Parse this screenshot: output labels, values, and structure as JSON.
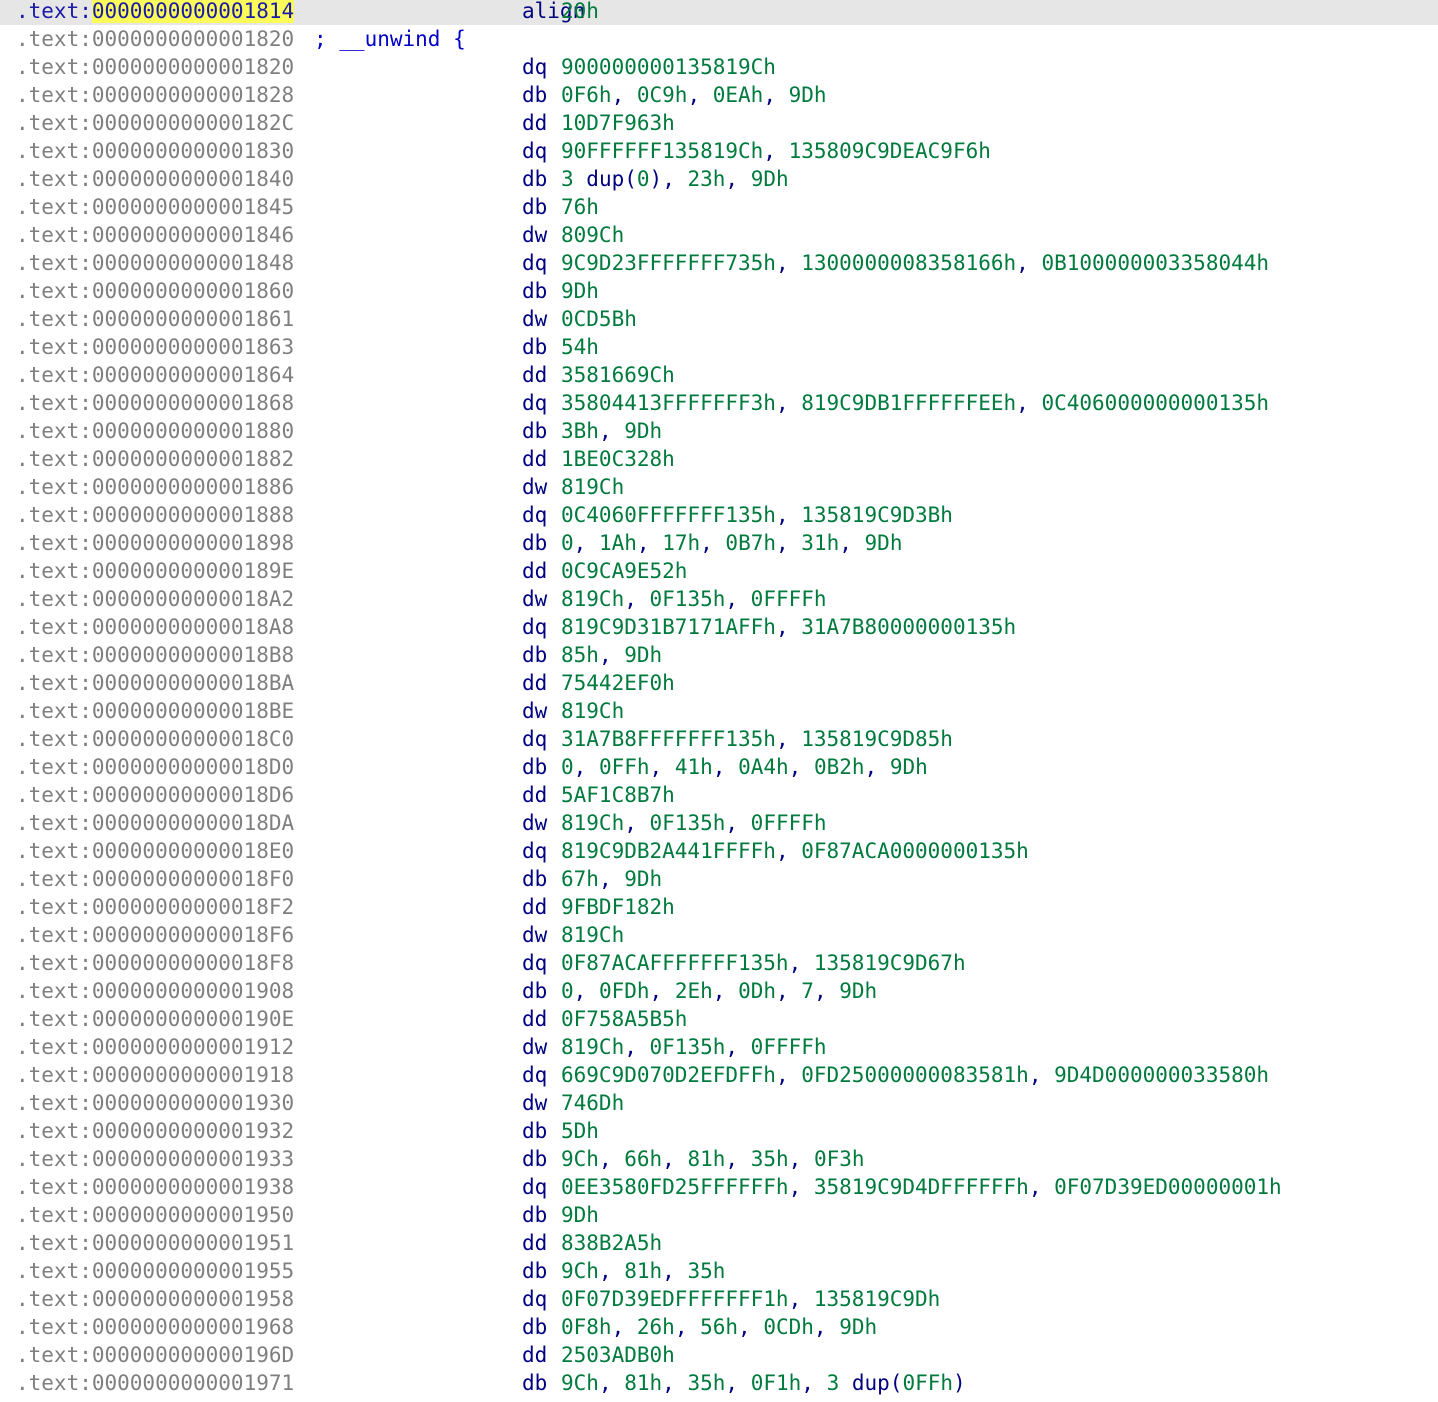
{
  "colors": {
    "address": "#7f7f7f",
    "address_current": "#1a1aa6",
    "current_highlight": "#fbfb5a",
    "current_line_bg": "#e6e6e6",
    "mnemonic": "#000080",
    "operand": "#007a3d",
    "comment": "#0000c8"
  },
  "listing": {
    "current_index": 0,
    "lines": [
      {
        "seg": ".text:",
        "offs": "0000000000001814",
        "mnem": "align",
        "ops": "20h"
      },
      {
        "seg": ".text:",
        "offs": "0000000000001820",
        "comment": "; __unwind {"
      },
      {
        "seg": ".text:",
        "offs": "0000000000001820",
        "mnem": "dq",
        "ops": "900000000135819Ch"
      },
      {
        "seg": ".text:",
        "offs": "0000000000001828",
        "mnem": "db",
        "ops": "0F6h, 0C9h, 0EAh, 9Dh"
      },
      {
        "seg": ".text:",
        "offs": "000000000000182C",
        "mnem": "dd",
        "ops": "10D7F963h"
      },
      {
        "seg": ".text:",
        "offs": "0000000000001830",
        "mnem": "dq",
        "ops": "90FFFFFF135819Ch, 135809C9DEAC9F6h"
      },
      {
        "seg": ".text:",
        "offs": "0000000000001840",
        "mnem": "db",
        "ops": "3 dup(0), 23h, 9Dh"
      },
      {
        "seg": ".text:",
        "offs": "0000000000001845",
        "mnem": "db",
        "ops": "76h"
      },
      {
        "seg": ".text:",
        "offs": "0000000000001846",
        "mnem": "dw",
        "ops": "809Ch"
      },
      {
        "seg": ".text:",
        "offs": "0000000000001848",
        "mnem": "dq",
        "ops": "9C9D23FFFFFFF735h, 1300000008358166h, 0B100000003358044h"
      },
      {
        "seg": ".text:",
        "offs": "0000000000001860",
        "mnem": "db",
        "ops": "9Dh"
      },
      {
        "seg": ".text:",
        "offs": "0000000000001861",
        "mnem": "dw",
        "ops": "0CD5Bh"
      },
      {
        "seg": ".text:",
        "offs": "0000000000001863",
        "mnem": "db",
        "ops": "54h"
      },
      {
        "seg": ".text:",
        "offs": "0000000000001864",
        "mnem": "dd",
        "ops": "3581669Ch"
      },
      {
        "seg": ".text:",
        "offs": "0000000000001868",
        "mnem": "dq",
        "ops": "35804413FFFFFFF3h, 819C9DB1FFFFFFEEh, 0C406000000000135h"
      },
      {
        "seg": ".text:",
        "offs": "0000000000001880",
        "mnem": "db",
        "ops": "3Bh, 9Dh"
      },
      {
        "seg": ".text:",
        "offs": "0000000000001882",
        "mnem": "dd",
        "ops": "1BE0C328h"
      },
      {
        "seg": ".text:",
        "offs": "0000000000001886",
        "mnem": "dw",
        "ops": "819Ch"
      },
      {
        "seg": ".text:",
        "offs": "0000000000001888",
        "mnem": "dq",
        "ops": "0C4060FFFFFFF135h, 135819C9D3Bh"
      },
      {
        "seg": ".text:",
        "offs": "0000000000001898",
        "mnem": "db",
        "ops": "0, 1Ah, 17h, 0B7h, 31h, 9Dh"
      },
      {
        "seg": ".text:",
        "offs": "000000000000189E",
        "mnem": "dd",
        "ops": "0C9CA9E52h"
      },
      {
        "seg": ".text:",
        "offs": "00000000000018A2",
        "mnem": "dw",
        "ops": "819Ch, 0F135h, 0FFFFh"
      },
      {
        "seg": ".text:",
        "offs": "00000000000018A8",
        "mnem": "dq",
        "ops": "819C9D31B7171AFFh, 31A7B80000000135h"
      },
      {
        "seg": ".text:",
        "offs": "00000000000018B8",
        "mnem": "db",
        "ops": "85h, 9Dh"
      },
      {
        "seg": ".text:",
        "offs": "00000000000018BA",
        "mnem": "dd",
        "ops": "75442EF0h"
      },
      {
        "seg": ".text:",
        "offs": "00000000000018BE",
        "mnem": "dw",
        "ops": "819Ch"
      },
      {
        "seg": ".text:",
        "offs": "00000000000018C0",
        "mnem": "dq",
        "ops": "31A7B8FFFFFFF135h, 135819C9D85h"
      },
      {
        "seg": ".text:",
        "offs": "00000000000018D0",
        "mnem": "db",
        "ops": "0, 0FFh, 41h, 0A4h, 0B2h, 9Dh"
      },
      {
        "seg": ".text:",
        "offs": "00000000000018D6",
        "mnem": "dd",
        "ops": "5AF1C8B7h"
      },
      {
        "seg": ".text:",
        "offs": "00000000000018DA",
        "mnem": "dw",
        "ops": "819Ch, 0F135h, 0FFFFh"
      },
      {
        "seg": ".text:",
        "offs": "00000000000018E0",
        "mnem": "dq",
        "ops": "819C9DB2A441FFFFh, 0F87ACA0000000135h"
      },
      {
        "seg": ".text:",
        "offs": "00000000000018F0",
        "mnem": "db",
        "ops": "67h, 9Dh"
      },
      {
        "seg": ".text:",
        "offs": "00000000000018F2",
        "mnem": "dd",
        "ops": "9FBDF182h"
      },
      {
        "seg": ".text:",
        "offs": "00000000000018F6",
        "mnem": "dw",
        "ops": "819Ch"
      },
      {
        "seg": ".text:",
        "offs": "00000000000018F8",
        "mnem": "dq",
        "ops": "0F87ACAFFFFFFF135h, 135819C9D67h"
      },
      {
        "seg": ".text:",
        "offs": "0000000000001908",
        "mnem": "db",
        "ops": "0, 0FDh, 2Eh, 0Dh, 7, 9Dh"
      },
      {
        "seg": ".text:",
        "offs": "000000000000190E",
        "mnem": "dd",
        "ops": "0F758A5B5h"
      },
      {
        "seg": ".text:",
        "offs": "0000000000001912",
        "mnem": "dw",
        "ops": "819Ch, 0F135h, 0FFFFh"
      },
      {
        "seg": ".text:",
        "offs": "0000000000001918",
        "mnem": "dq",
        "ops": "669C9D070D2EFDFFh, 0FD25000000083581h, 9D4D000000033580h"
      },
      {
        "seg": ".text:",
        "offs": "0000000000001930",
        "mnem": "dw",
        "ops": "746Dh"
      },
      {
        "seg": ".text:",
        "offs": "0000000000001932",
        "mnem": "db",
        "ops": "5Dh"
      },
      {
        "seg": ".text:",
        "offs": "0000000000001933",
        "mnem": "db",
        "ops": "9Ch, 66h, 81h, 35h, 0F3h"
      },
      {
        "seg": ".text:",
        "offs": "0000000000001938",
        "mnem": "dq",
        "ops": "0EE3580FD25FFFFFFh, 35819C9D4DFFFFFFh, 0F07D39ED00000001h"
      },
      {
        "seg": ".text:",
        "offs": "0000000000001950",
        "mnem": "db",
        "ops": "9Dh"
      },
      {
        "seg": ".text:",
        "offs": "0000000000001951",
        "mnem": "dd",
        "ops": "838B2A5h"
      },
      {
        "seg": ".text:",
        "offs": "0000000000001955",
        "mnem": "db",
        "ops": "9Ch, 81h, 35h"
      },
      {
        "seg": ".text:",
        "offs": "0000000000001958",
        "mnem": "dq",
        "ops": "0F07D39EDFFFFFFF1h, 135819C9Dh"
      },
      {
        "seg": ".text:",
        "offs": "0000000000001968",
        "mnem": "db",
        "ops": "0F8h, 26h, 56h, 0CDh, 9Dh"
      },
      {
        "seg": ".text:",
        "offs": "000000000000196D",
        "mnem": "dd",
        "ops": "2503ADB0h"
      },
      {
        "seg": ".text:",
        "offs": "0000000000001971",
        "mnem": "db",
        "ops": "9Ch, 81h, 35h, 0F1h, 3 dup(0FFh)"
      }
    ]
  }
}
